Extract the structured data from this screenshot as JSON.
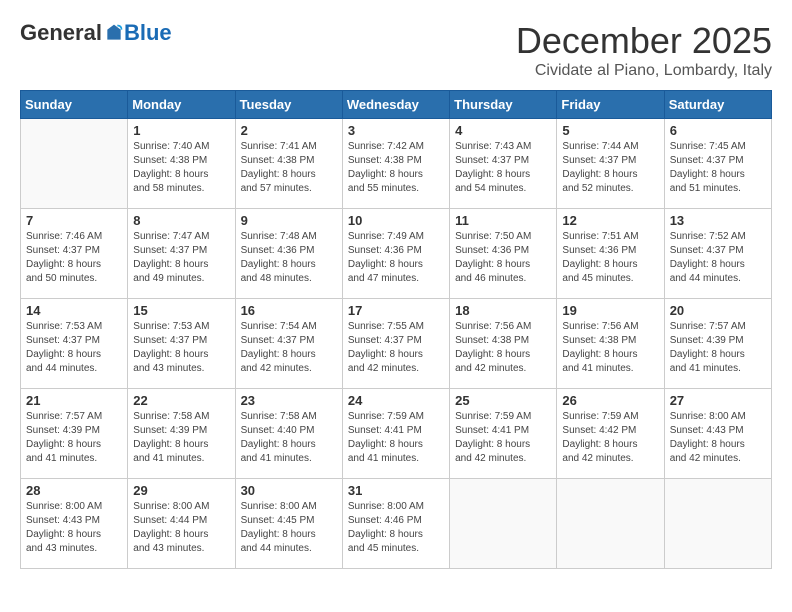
{
  "logo": {
    "general": "General",
    "blue": "Blue"
  },
  "title": "December 2025",
  "location": "Cividate al Piano, Lombardy, Italy",
  "days_of_week": [
    "Sunday",
    "Monday",
    "Tuesday",
    "Wednesday",
    "Thursday",
    "Friday",
    "Saturday"
  ],
  "weeks": [
    [
      {
        "day": "",
        "info": ""
      },
      {
        "day": "1",
        "info": "Sunrise: 7:40 AM\nSunset: 4:38 PM\nDaylight: 8 hours\nand 58 minutes."
      },
      {
        "day": "2",
        "info": "Sunrise: 7:41 AM\nSunset: 4:38 PM\nDaylight: 8 hours\nand 57 minutes."
      },
      {
        "day": "3",
        "info": "Sunrise: 7:42 AM\nSunset: 4:38 PM\nDaylight: 8 hours\nand 55 minutes."
      },
      {
        "day": "4",
        "info": "Sunrise: 7:43 AM\nSunset: 4:37 PM\nDaylight: 8 hours\nand 54 minutes."
      },
      {
        "day": "5",
        "info": "Sunrise: 7:44 AM\nSunset: 4:37 PM\nDaylight: 8 hours\nand 52 minutes."
      },
      {
        "day": "6",
        "info": "Sunrise: 7:45 AM\nSunset: 4:37 PM\nDaylight: 8 hours\nand 51 minutes."
      }
    ],
    [
      {
        "day": "7",
        "info": "Sunrise: 7:46 AM\nSunset: 4:37 PM\nDaylight: 8 hours\nand 50 minutes."
      },
      {
        "day": "8",
        "info": "Sunrise: 7:47 AM\nSunset: 4:37 PM\nDaylight: 8 hours\nand 49 minutes."
      },
      {
        "day": "9",
        "info": "Sunrise: 7:48 AM\nSunset: 4:36 PM\nDaylight: 8 hours\nand 48 minutes."
      },
      {
        "day": "10",
        "info": "Sunrise: 7:49 AM\nSunset: 4:36 PM\nDaylight: 8 hours\nand 47 minutes."
      },
      {
        "day": "11",
        "info": "Sunrise: 7:50 AM\nSunset: 4:36 PM\nDaylight: 8 hours\nand 46 minutes."
      },
      {
        "day": "12",
        "info": "Sunrise: 7:51 AM\nSunset: 4:36 PM\nDaylight: 8 hours\nand 45 minutes."
      },
      {
        "day": "13",
        "info": "Sunrise: 7:52 AM\nSunset: 4:37 PM\nDaylight: 8 hours\nand 44 minutes."
      }
    ],
    [
      {
        "day": "14",
        "info": "Sunrise: 7:53 AM\nSunset: 4:37 PM\nDaylight: 8 hours\nand 44 minutes."
      },
      {
        "day": "15",
        "info": "Sunrise: 7:53 AM\nSunset: 4:37 PM\nDaylight: 8 hours\nand 43 minutes."
      },
      {
        "day": "16",
        "info": "Sunrise: 7:54 AM\nSunset: 4:37 PM\nDaylight: 8 hours\nand 42 minutes."
      },
      {
        "day": "17",
        "info": "Sunrise: 7:55 AM\nSunset: 4:37 PM\nDaylight: 8 hours\nand 42 minutes."
      },
      {
        "day": "18",
        "info": "Sunrise: 7:56 AM\nSunset: 4:38 PM\nDaylight: 8 hours\nand 42 minutes."
      },
      {
        "day": "19",
        "info": "Sunrise: 7:56 AM\nSunset: 4:38 PM\nDaylight: 8 hours\nand 41 minutes."
      },
      {
        "day": "20",
        "info": "Sunrise: 7:57 AM\nSunset: 4:39 PM\nDaylight: 8 hours\nand 41 minutes."
      }
    ],
    [
      {
        "day": "21",
        "info": "Sunrise: 7:57 AM\nSunset: 4:39 PM\nDaylight: 8 hours\nand 41 minutes."
      },
      {
        "day": "22",
        "info": "Sunrise: 7:58 AM\nSunset: 4:39 PM\nDaylight: 8 hours\nand 41 minutes."
      },
      {
        "day": "23",
        "info": "Sunrise: 7:58 AM\nSunset: 4:40 PM\nDaylight: 8 hours\nand 41 minutes."
      },
      {
        "day": "24",
        "info": "Sunrise: 7:59 AM\nSunset: 4:41 PM\nDaylight: 8 hours\nand 41 minutes."
      },
      {
        "day": "25",
        "info": "Sunrise: 7:59 AM\nSunset: 4:41 PM\nDaylight: 8 hours\nand 42 minutes."
      },
      {
        "day": "26",
        "info": "Sunrise: 7:59 AM\nSunset: 4:42 PM\nDaylight: 8 hours\nand 42 minutes."
      },
      {
        "day": "27",
        "info": "Sunrise: 8:00 AM\nSunset: 4:43 PM\nDaylight: 8 hours\nand 42 minutes."
      }
    ],
    [
      {
        "day": "28",
        "info": "Sunrise: 8:00 AM\nSunset: 4:43 PM\nDaylight: 8 hours\nand 43 minutes."
      },
      {
        "day": "29",
        "info": "Sunrise: 8:00 AM\nSunset: 4:44 PM\nDaylight: 8 hours\nand 43 minutes."
      },
      {
        "day": "30",
        "info": "Sunrise: 8:00 AM\nSunset: 4:45 PM\nDaylight: 8 hours\nand 44 minutes."
      },
      {
        "day": "31",
        "info": "Sunrise: 8:00 AM\nSunset: 4:46 PM\nDaylight: 8 hours\nand 45 minutes."
      },
      {
        "day": "",
        "info": ""
      },
      {
        "day": "",
        "info": ""
      },
      {
        "day": "",
        "info": ""
      }
    ]
  ]
}
